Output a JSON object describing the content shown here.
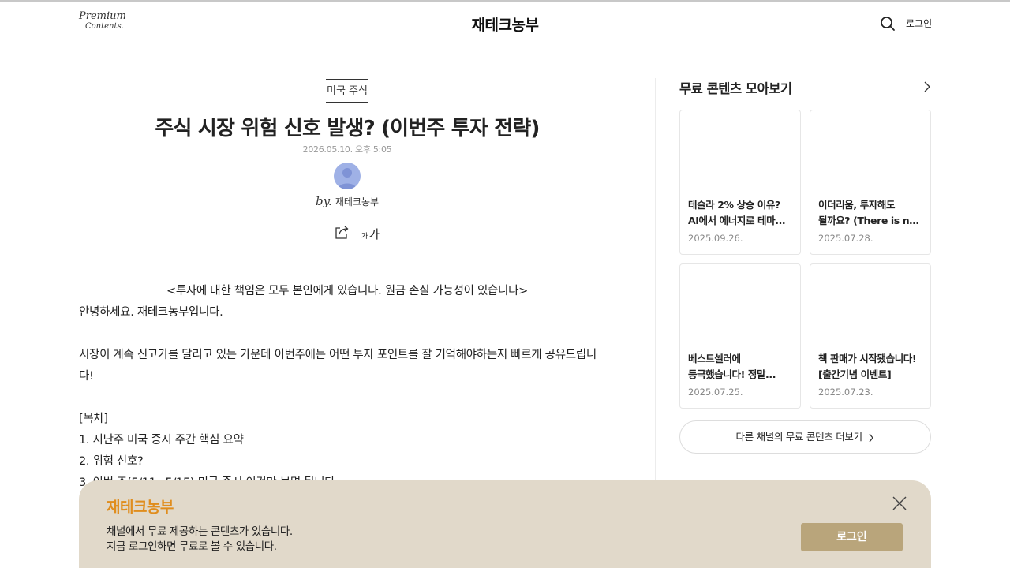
{
  "header": {
    "logo_line1": "Premium",
    "logo_line2": "Contents.",
    "site_title": "재테크농부",
    "login_label": "로그인",
    "search_icon": "search-icon"
  },
  "article": {
    "category": "미국 주식",
    "title": "주식 시장 위험 신호 발생? (이번주 투자 전략)",
    "date": "2026.05.10. 오후 5:05",
    "by_prefix": "by.",
    "author": "재테크농부",
    "font_small": "가",
    "font_large": "가",
    "disclaimer": "<투자에 대한 책임은 모두 본인에게 있습니다. 원금 손실 가능성이 있습니다>",
    "greeting": "안녕하세요. 재테크농부입니다.",
    "intro_line1": "시장이 계속 신고가를 달리고 있는 가운데 이번주에는 어떤 투자 포인트를 잘 기억해야하는지 빠르게 공유드립니",
    "intro_line2": "다!",
    "toc_heading": "[목차]",
    "toc_items": [
      "1. 지난주 미국 증시 주간 핵심 요약",
      "2. 위험 신호?",
      "3. 이번 주(5/11~5/15) 미국 증시 이것만 보면 됩니다"
    ]
  },
  "sidebar": {
    "title": "무료 콘텐츠 모아보기",
    "cards": [
      {
        "line1": "테슬라 2% 상승 이유?",
        "line2": "AI에서 에너지로 테마...",
        "date": "2025.09.26."
      },
      {
        "line1": "이더리움, 투자해도",
        "line2": "될까요? (There is no...",
        "date": "2025.07.28."
      },
      {
        "line1": "베스트셀러에",
        "line2": "등극했습니다! 정말...",
        "date": "2025.07.25."
      },
      {
        "line1": "책 판매가 시작됐습니다!",
        "line2": "[출간기념 이벤트]",
        "date": "2025.07.23."
      }
    ],
    "more_label": "다른 채널의 무료 콘텐츠 더보기"
  },
  "banner": {
    "title": "재테크농부",
    "line1": "채널에서 무료 제공하는 콘텐츠가 있습니다.",
    "line2": "지금 로그인하면 무료로 볼 수 있습니다.",
    "login_label": "로그인"
  },
  "colors": {
    "banner_bg": "#e1d9ca",
    "banner_title": "#e08d1d",
    "banner_button": "#b9a57b",
    "avatar": "#9fb1e6"
  }
}
